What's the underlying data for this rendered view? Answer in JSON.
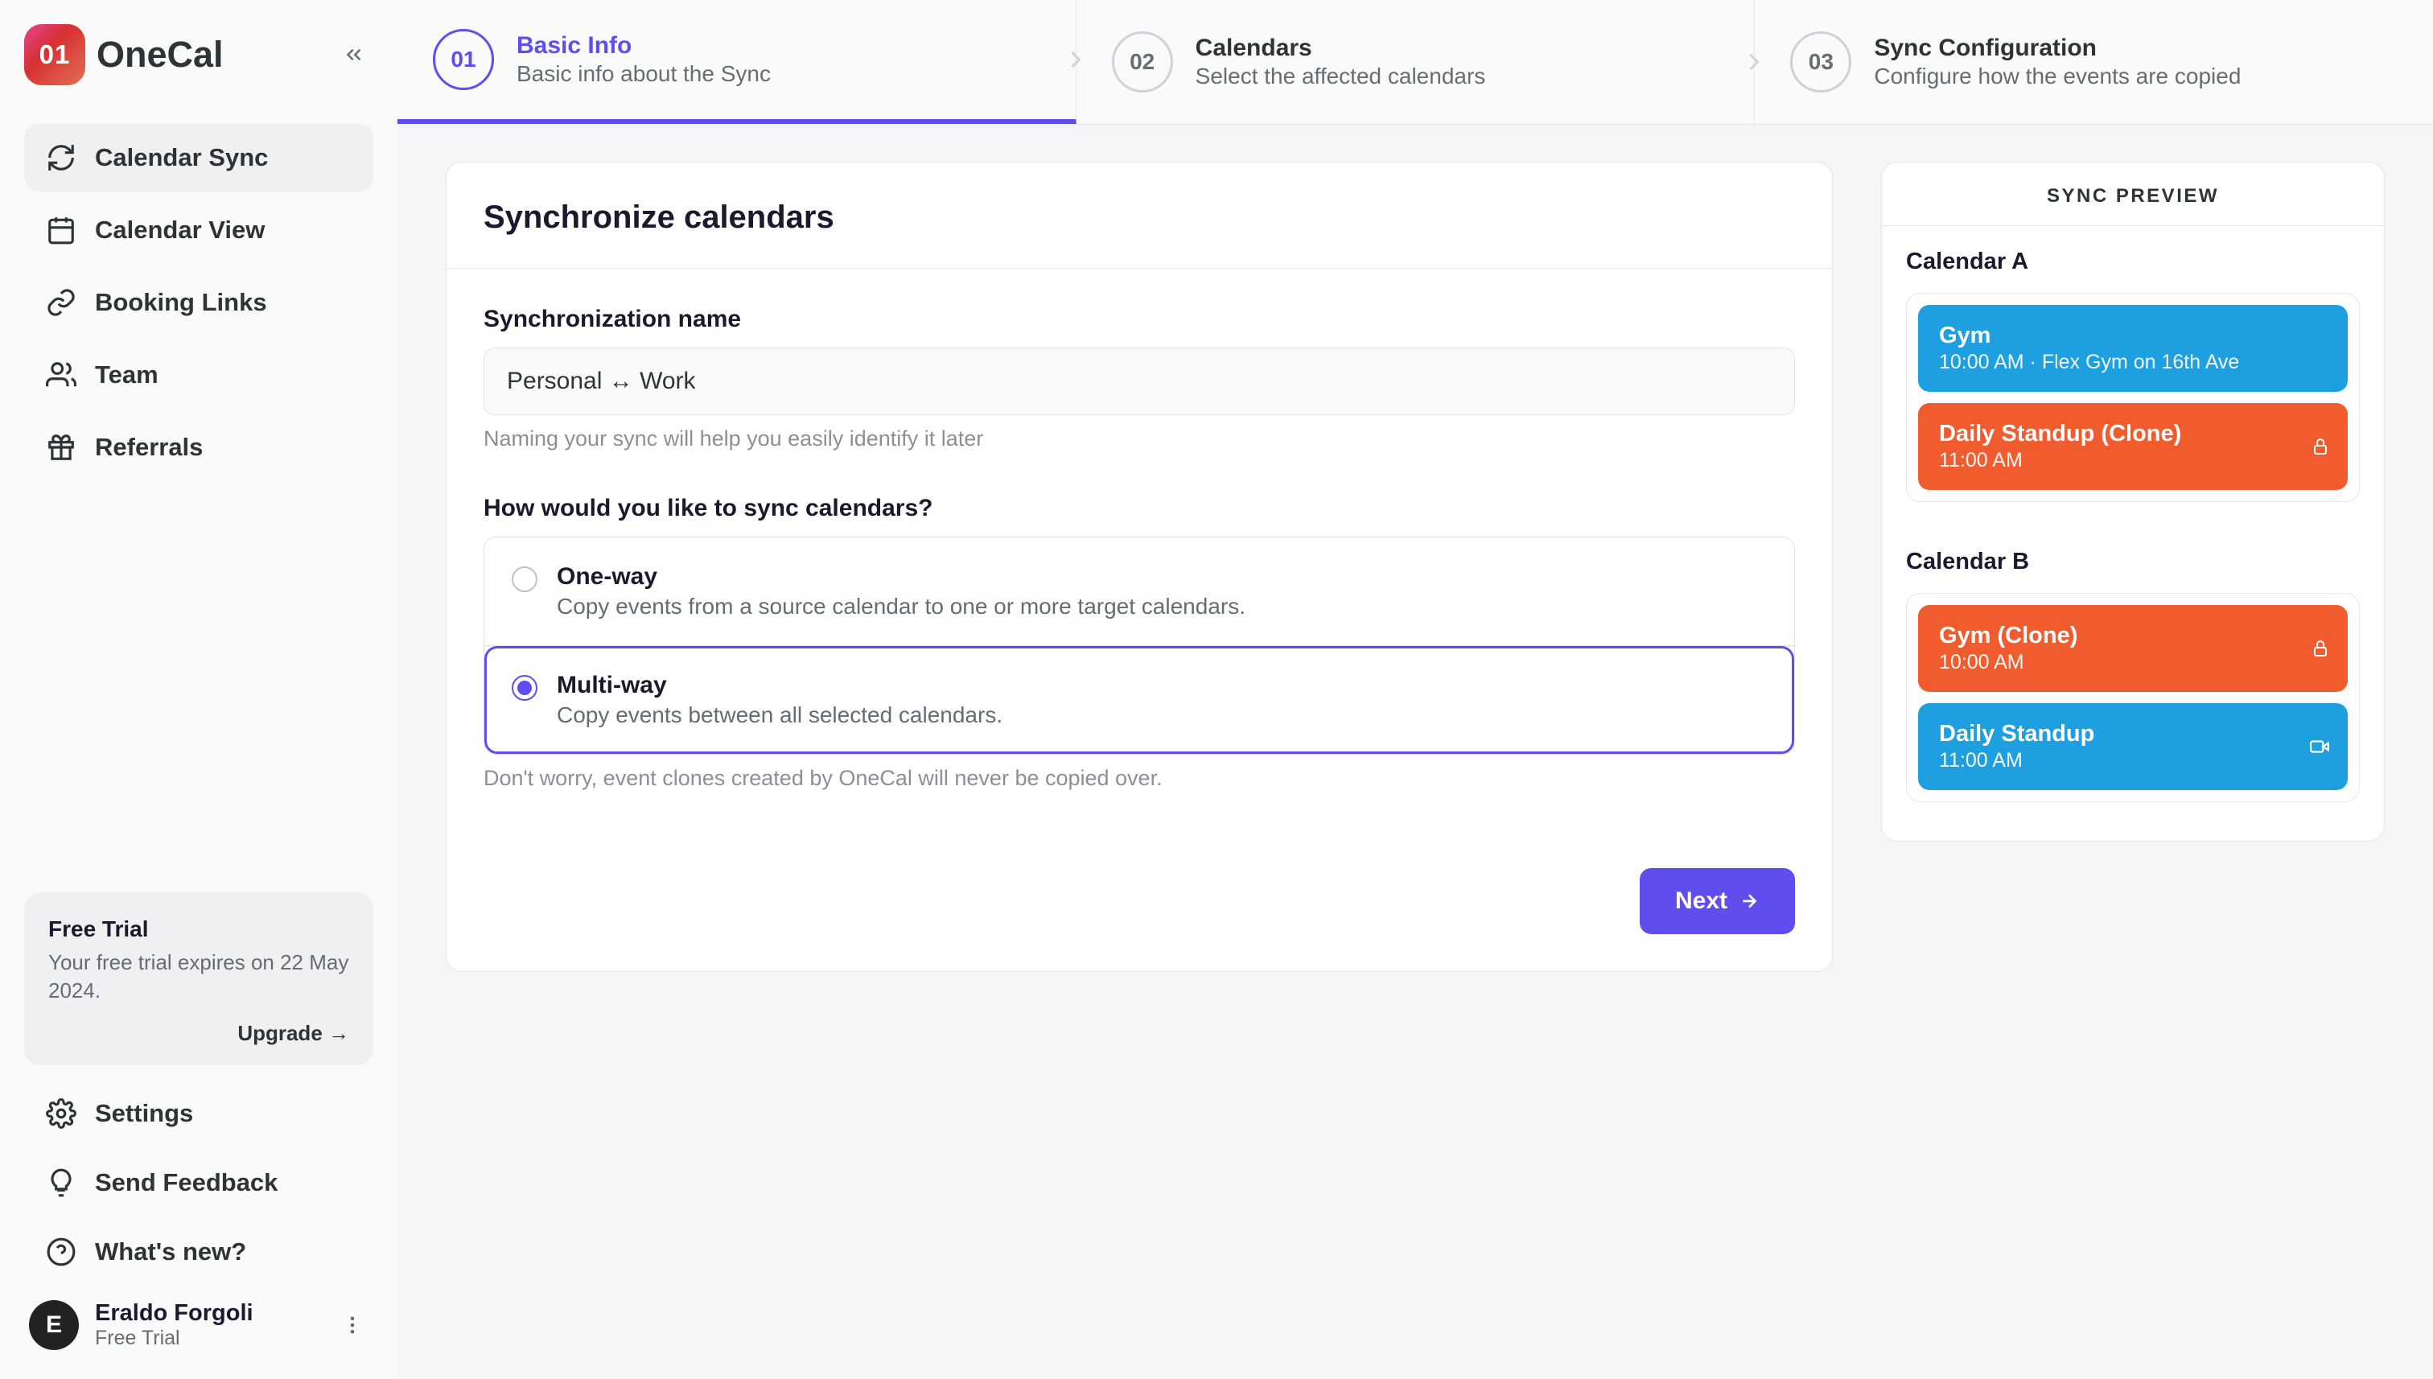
{
  "brand": {
    "mark": "01",
    "name": "OneCal"
  },
  "sidebar": {
    "items": [
      {
        "label": "Calendar Sync"
      },
      {
        "label": "Calendar View"
      },
      {
        "label": "Booking Links"
      },
      {
        "label": "Team"
      },
      {
        "label": "Referrals"
      }
    ],
    "trial": {
      "title": "Free Trial",
      "body": "Your free trial expires on 22 May 2024.",
      "upgrade": "Upgrade →"
    },
    "footer": [
      {
        "label": "Settings"
      },
      {
        "label": "Send Feedback"
      },
      {
        "label": "What's new?"
      }
    ],
    "user": {
      "initial": "E",
      "name": "Eraldo Forgoli",
      "plan": "Free Trial"
    }
  },
  "stepper": [
    {
      "num": "01",
      "title": "Basic Info",
      "sub": "Basic info about the Sync"
    },
    {
      "num": "02",
      "title": "Calendars",
      "sub": "Select the affected calendars"
    },
    {
      "num": "03",
      "title": "Sync Configuration",
      "sub": "Configure how the events are copied"
    }
  ],
  "form": {
    "title": "Synchronize calendars",
    "name_label": "Synchronization name",
    "name_value": "Personal ↔ Work",
    "name_hint": "Naming your sync will help you easily identify it later",
    "mode_label": "How would you like to sync calendars?",
    "options": [
      {
        "title": "One-way",
        "desc": "Copy events from a source calendar to one or more target calendars."
      },
      {
        "title": "Multi-way",
        "desc": "Copy events between all selected calendars."
      }
    ],
    "mode_hint": "Don't worry, event clones created by OneCal will never be copied over.",
    "next": "Next"
  },
  "preview": {
    "head": "SYNC PREVIEW",
    "calendars": [
      {
        "name": "Calendar A",
        "events": [
          {
            "title": "Gym",
            "sub": "10:00 AM · Flex Gym on 16th Ave",
            "color": "blue",
            "icon": ""
          },
          {
            "title": "Daily Standup (Clone)",
            "sub": "11:00 AM",
            "color": "orange",
            "icon": "lock"
          }
        ]
      },
      {
        "name": "Calendar B",
        "events": [
          {
            "title": "Gym (Clone)",
            "sub": "10:00 AM",
            "color": "orange",
            "icon": "lock"
          },
          {
            "title": "Daily Standup",
            "sub": "11:00 AM",
            "color": "blue",
            "icon": "video"
          }
        ]
      }
    ]
  }
}
